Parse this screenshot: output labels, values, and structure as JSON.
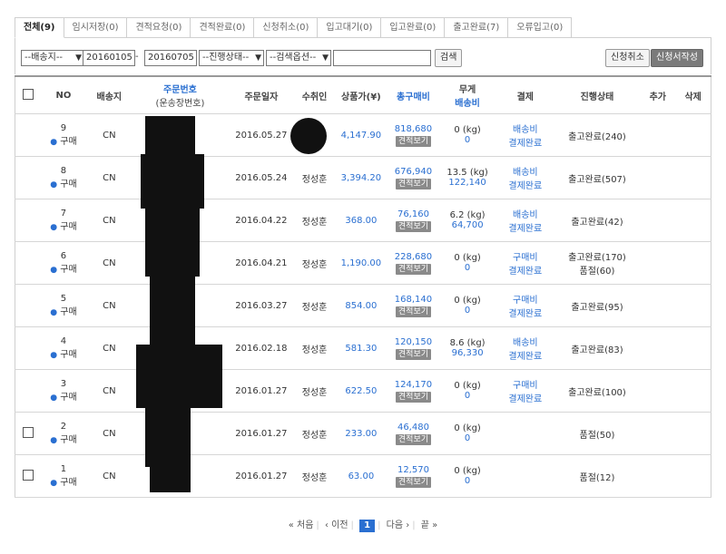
{
  "tabs": [
    "전체(9)",
    "임시저장(0)",
    "견적요청(0)",
    "견적완료(0)",
    "신청취소(0)",
    "입고대기(0)",
    "입고완료(0)",
    "출고완료(7)",
    "오류입고(0)"
  ],
  "filters": {
    "shipping_select": "--배송지--",
    "date_from": "20160105",
    "date_sep": "-",
    "date_to": "20160705",
    "status_select": "--진행상태--",
    "search_option_select": "--검색옵션--",
    "search_text": "",
    "search_button": "검색",
    "cancel_button": "신청취소",
    "write_button": "신청서작성"
  },
  "columns": {
    "no": "NO",
    "ship": "배송지",
    "order_no": "주문번호",
    "order_no_sub": "(운송장번호)",
    "date": "주문일자",
    "recipient": "수취인",
    "price": "상품가(¥)",
    "total": "총구매비",
    "weight": "무게",
    "weight_sub": "배송비",
    "payment": "결제",
    "status": "진행상태",
    "add": "추가",
    "delete": "삭제"
  },
  "quote_label": "견적보기",
  "buy_label": "구매",
  "rows": [
    {
      "no": "9",
      "ship": "CN",
      "date": "2016.05.27",
      "recipient": "",
      "price": "4,147.90",
      "total": "818,680",
      "weight": "0 (kg)",
      "fee": "0",
      "pay1": "배송비",
      "pay2": "결제완료",
      "status1": "출고완료(240)",
      "status2": "",
      "checkbox": false
    },
    {
      "no": "8",
      "ship": "CN",
      "date": "2016.05.24",
      "recipient": "정성훈",
      "price": "3,394.20",
      "total": "676,940",
      "weight": "13.5 (kg)",
      "fee": "122,140",
      "pay1": "배송비",
      "pay2": "결제완료",
      "status1": "출고완료(507)",
      "status2": "",
      "checkbox": false
    },
    {
      "no": "7",
      "ship": "CN",
      "date": "2016.04.22",
      "recipient": "정성훈",
      "price": "368.00",
      "total": "76,160",
      "weight": "6.2 (kg)",
      "fee": "64,700",
      "pay1": "배송비",
      "pay2": "결제완료",
      "status1": "출고완료(42)",
      "status2": "",
      "checkbox": false
    },
    {
      "no": "6",
      "ship": "CN",
      "date": "2016.04.21",
      "recipient": "정성훈",
      "price": "1,190.00",
      "total": "228,680",
      "weight": "0 (kg)",
      "fee": "0",
      "pay1": "구매비",
      "pay2": "결제완료",
      "status1": "출고완료(170)",
      "status2": "품절(60)",
      "checkbox": false
    },
    {
      "no": "5",
      "ship": "CN",
      "date": "2016.03.27",
      "recipient": "정성훈",
      "price": "854.00",
      "total": "168,140",
      "weight": "0 (kg)",
      "fee": "0",
      "pay1": "구매비",
      "pay2": "결제완료",
      "status1": "출고완료(95)",
      "status2": "",
      "checkbox": false
    },
    {
      "no": "4",
      "ship": "CN",
      "date": "2016.02.18",
      "recipient": "정성훈",
      "price": "581.30",
      "total": "120,150",
      "weight": "8.6 (kg)",
      "fee": "96,330",
      "pay1": "배송비",
      "pay2": "결제완료",
      "status1": "출고완료(83)",
      "status2": "",
      "checkbox": false
    },
    {
      "no": "3",
      "ship": "CN",
      "date": "2016.01.27",
      "recipient": "정성훈",
      "price": "622.50",
      "total": "124,170",
      "weight": "0 (kg)",
      "fee": "0",
      "pay1": "구매비",
      "pay2": "결제완료",
      "status1": "출고완료(100)",
      "status2": "",
      "checkbox": false
    },
    {
      "no": "2",
      "ship": "CN",
      "date": "2016.01.27",
      "recipient": "정성훈",
      "price": "233.00",
      "total": "46,480",
      "weight": "0 (kg)",
      "fee": "0",
      "pay1": "",
      "pay2": "",
      "status1": "품절(50)",
      "status2": "",
      "checkbox": true
    },
    {
      "no": "1",
      "ship": "CN",
      "date": "2016.01.27",
      "recipient": "정성훈",
      "price": "63.00",
      "total": "12,570",
      "weight": "0 (kg)",
      "fee": "0",
      "pay1": "",
      "pay2": "",
      "status1": "품절(12)",
      "status2": "",
      "checkbox": true
    }
  ],
  "pager": {
    "first": "« 처음",
    "prev": "‹ 이전",
    "current": "1",
    "next": "다음 ›",
    "last": "끝 »"
  },
  "colors": {
    "accent": "#2a6fd1",
    "button_dark": "#7b7b7b"
  }
}
